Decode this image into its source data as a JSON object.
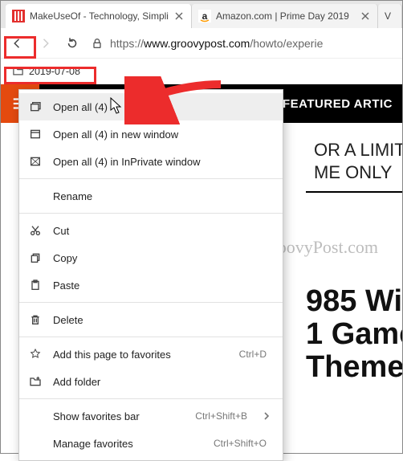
{
  "tabs": [
    {
      "title": "MakeUseOf - Technology, Simpli",
      "favicon_color": "#e3302e"
    },
    {
      "title": "Amazon.com | Prime Day 2019",
      "favicon_letter": "a"
    },
    {
      "title": "V"
    }
  ],
  "address_bar": {
    "scheme": "https://",
    "host": "www.groovypost.com",
    "path": "/howto/experie"
  },
  "bookmarks": {
    "folder_label": "2019-07-08"
  },
  "page": {
    "featured_label": "FEATURED ARTIC",
    "promo_line1": "OR A LIMITED",
    "promo_line2": "ME ONLY",
    "headline_line1": "985 Wi",
    "headline_line2": "1 Game",
    "headline_line3": "Theme",
    "watermark": "groovyPost.com"
  },
  "context_menu": {
    "open_all": "Open all (4)",
    "open_all_new_window": "Open all (4) in new window",
    "open_all_inprivate": "Open all (4) in InPrivate window",
    "rename": "Rename",
    "cut": "Cut",
    "copy": "Copy",
    "paste": "Paste",
    "delete": "Delete",
    "add_page": "Add this page to favorites",
    "add_page_shortcut": "Ctrl+D",
    "add_folder": "Add folder",
    "show_bar": "Show favorites bar",
    "show_bar_shortcut": "Ctrl+Shift+B",
    "manage": "Manage favorites",
    "manage_shortcut": "Ctrl+Shift+O"
  }
}
